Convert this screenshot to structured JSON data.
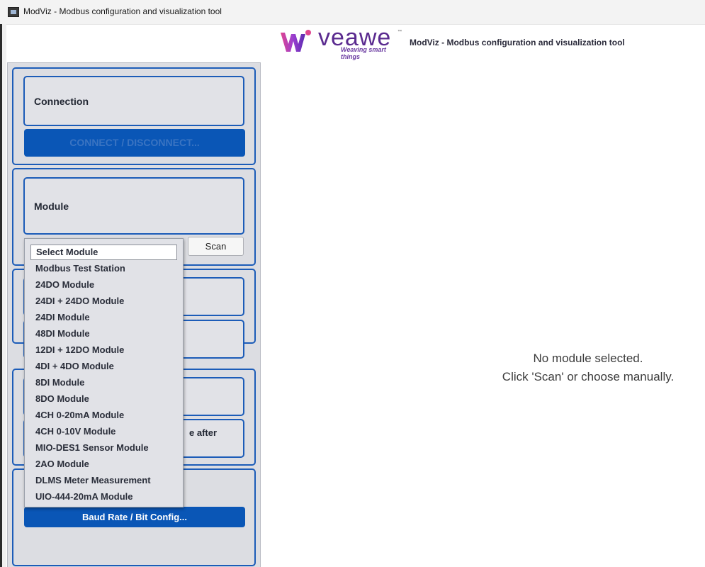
{
  "window": {
    "title": "ModViz - Modbus configuration and visualization tool"
  },
  "header": {
    "logo_word": "veawe",
    "logo_tm": "™",
    "logo_tagline": "Weaving smart things",
    "app_title": "ModViz - Modbus configuration and visualization tool"
  },
  "sidebar": {
    "connection": {
      "label": "Connection",
      "connect_button": "CONNECT / DISCONNECT..."
    },
    "module": {
      "label": "Module",
      "scan_button": "Scan",
      "select_value": "Select Module",
      "options": [
        "Modbus Test Station",
        "24DO Module",
        "24DI + 24DO Module",
        "24DI Module",
        "48DI Module",
        "12DI + 12DO Module",
        "4DI + 4DO Module",
        "8DI Module",
        "8DO Module",
        "4CH 0-20mA Module",
        "4CH 0-10V Module",
        "MIO-DES1 Sensor Module",
        "2AO Module",
        "DLMS Meter Measurement",
        "UIO-444-20mA Module"
      ]
    },
    "partial_text": "e after",
    "baud_button": "Baud Rate / Bit Config..."
  },
  "main": {
    "empty_line1": "No module selected.",
    "empty_line2": "Click 'Scan' or choose manually."
  },
  "colors": {
    "accent": "#0a56b6",
    "group_border": "#1c5cb8",
    "panel": "#dcdde2"
  }
}
